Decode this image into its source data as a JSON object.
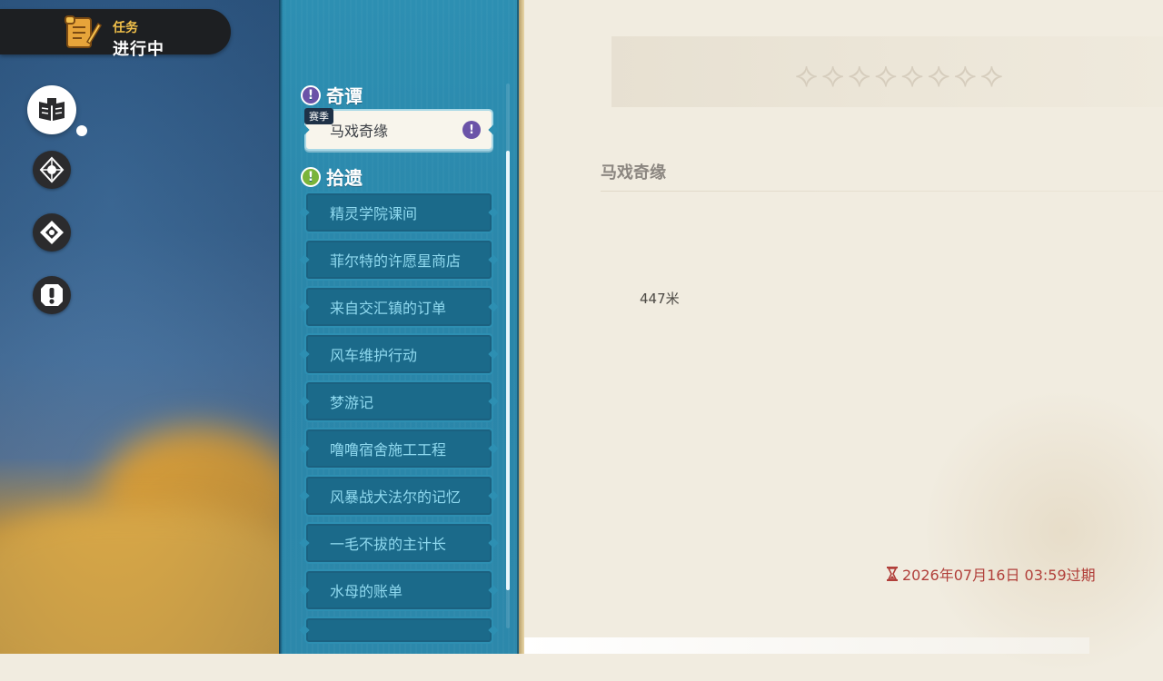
{
  "header": {
    "category": "任务",
    "status": "进行中"
  },
  "left_nav": {
    "items": [
      {
        "icon": "book-icon",
        "active": true
      },
      {
        "icon": "compass-icon",
        "active": false
      },
      {
        "icon": "diamond-icon",
        "active": false
      },
      {
        "icon": "exclamation-icon",
        "active": false
      }
    ]
  },
  "quest_list": {
    "sections": [
      {
        "title": "奇谭",
        "icon_color": "#6b53a8",
        "items": [
          {
            "label": "马戏奇缘",
            "tag": "赛季",
            "selected": true
          }
        ]
      },
      {
        "title": "拾遗",
        "icon_color": "#7ab43a",
        "items": [
          {
            "label": "精灵学院课间"
          },
          {
            "label": "菲尔特的许愿星商店"
          },
          {
            "label": "来自交汇镇的订单"
          },
          {
            "label": "风车维护行动"
          },
          {
            "label": "梦游记"
          },
          {
            "label": "噜噜宿舍施工工程"
          },
          {
            "label": "风暴战犬法尔的记忆"
          },
          {
            "label": "一毛不拔的主计长"
          },
          {
            "label": "水母的账单"
          }
        ]
      }
    ]
  },
  "detail": {
    "title": "马戏奇缘",
    "distance": "447米",
    "expire": "2026年07月16日 03:59过期",
    "expire_icon": "hourglass-icon"
  },
  "colors": {
    "panel_blue": "#2a86a9",
    "item_blue": "#1b6a8a",
    "item_text": "#8fd9ef",
    "expire_red": "#b13f3a"
  }
}
